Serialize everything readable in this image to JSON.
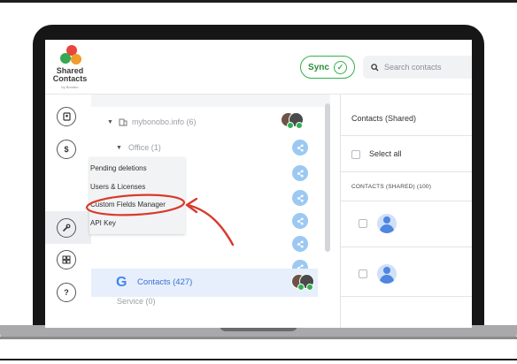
{
  "brand": {
    "name_line1": "Shared",
    "name_line2": "Contacts",
    "sub": "by Bonobo",
    "colors": {
      "red": "#e8453c",
      "green": "#36a852",
      "orange": "#f19c2b",
      "accent_green": "#35b04a",
      "link_blue": "#3a6fd8"
    }
  },
  "header": {
    "sync_label": "Sync",
    "search_placeholder": "Search contacts"
  },
  "rail": {
    "items": [
      {
        "icon": "contacts-card-icon"
      },
      {
        "icon": "dollar-icon",
        "glyph": "$"
      },
      {
        "icon": "wrench-icon"
      },
      {
        "icon": "grid-icon"
      },
      {
        "icon": "help-icon",
        "glyph": "?"
      }
    ]
  },
  "tree": {
    "domain_label": "mybonobo.info (6)",
    "office_label": "Office (1)",
    "service_label": "Service (0)",
    "contacts_label": "Contacts (427)"
  },
  "menu": {
    "items": [
      "Pending deletions",
      "Users & Licenses",
      "Custom Fields Manager",
      "API Key"
    ]
  },
  "right": {
    "title": "Contacts (Shared)",
    "select_all": "Select all",
    "section_head": "CONTACTS (SHARED) (100)"
  },
  "annotation": {
    "color": "#d93a2b",
    "target": "Custom Fields Manager"
  }
}
